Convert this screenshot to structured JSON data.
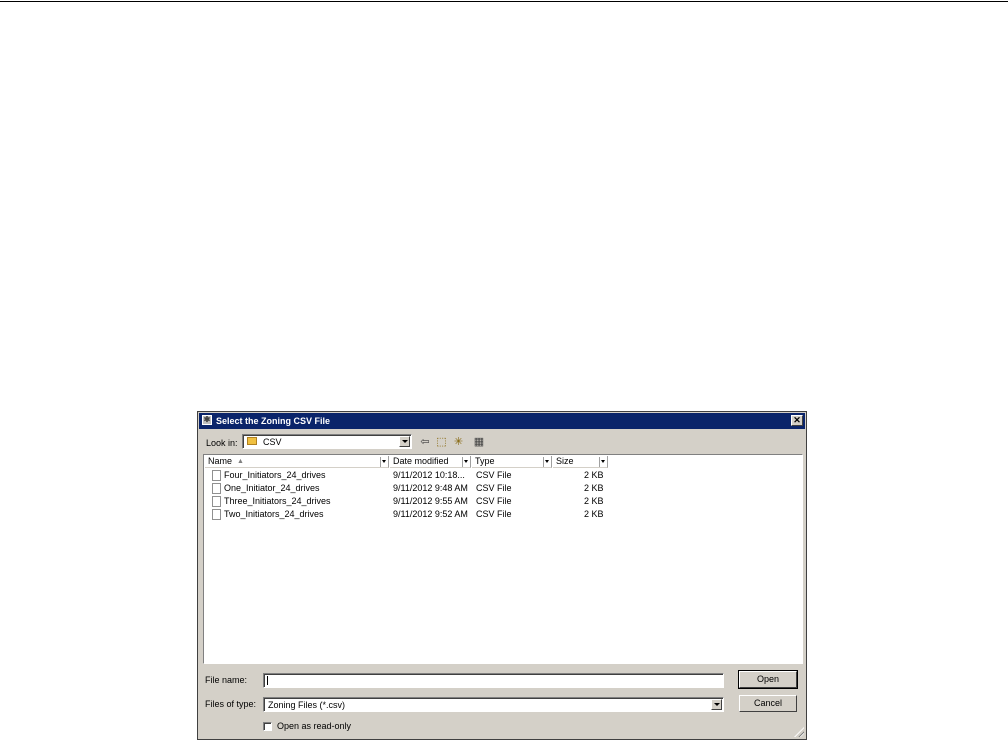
{
  "dialog": {
    "title": "Select the Zoning CSV File",
    "close_glyph": "✕",
    "title_icon_glyph": "✱"
  },
  "look_in": {
    "label": "Look in:",
    "value": "CSV"
  },
  "toolbar": {
    "back_icon": "⇦",
    "up_folder_icon": "⬚",
    "new_folder_icon": "✳",
    "view_menu_icon": "▦"
  },
  "columns": [
    "Name",
    "Date modified",
    "Type",
    "Size"
  ],
  "sort_glyph": "▲",
  "files": [
    {
      "name": "Four_Initiators_24_drives",
      "date": "9/11/2012 10:18...",
      "type": "CSV File",
      "size": "2 KB"
    },
    {
      "name": "One_Initiator_24_drives",
      "date": "9/11/2012 9:48 AM",
      "type": "CSV File",
      "size": "2 KB"
    },
    {
      "name": "Three_Initiators_24_drives",
      "date": "9/11/2012 9:55 AM",
      "type": "CSV File",
      "size": "2 KB"
    },
    {
      "name": "Two_Initiators_24_drives",
      "date": "9/11/2012 9:52 AM",
      "type": "CSV File",
      "size": "2 KB"
    }
  ],
  "file_name": {
    "label": "File name:",
    "value": ""
  },
  "file_type": {
    "label": "Files of type:",
    "value": "Zoning Files (*.csv)"
  },
  "buttons": {
    "open": "Open",
    "cancel": "Cancel"
  },
  "read_only": {
    "label": "Open as read-only",
    "checked": false
  },
  "colors": {
    "titlebar": "#0a246a",
    "dialog_face": "#d4d0c8"
  }
}
